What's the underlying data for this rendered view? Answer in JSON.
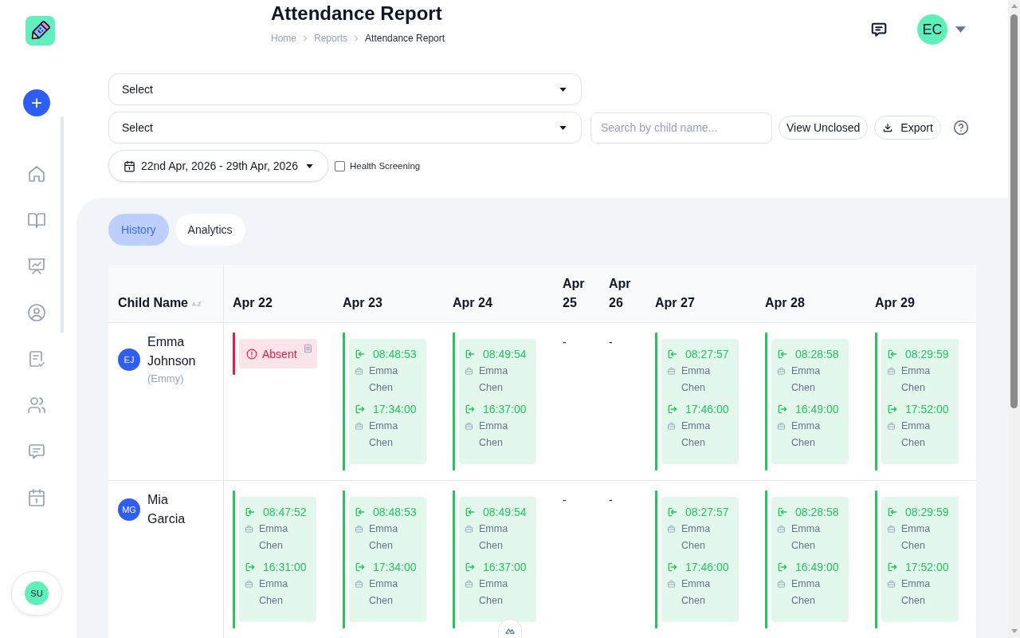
{
  "sidebar": {
    "user": {
      "initials": "SU"
    }
  },
  "header": {
    "title": "Attendance Report",
    "breadcrumb": [
      {
        "label": "Home",
        "current": false
      },
      {
        "label": "Reports",
        "current": false
      },
      {
        "label": "Attendance Report",
        "current": true
      }
    ],
    "user": {
      "initials": "EC"
    }
  },
  "filters": {
    "selects": [
      {
        "value": "Select"
      },
      {
        "value": "Select"
      }
    ],
    "search": {
      "placeholder": "Search by child name..."
    },
    "buttons": [
      {
        "label": "View Unclosed",
        "kind": "plain"
      },
      {
        "label": "Export",
        "kind": "download"
      }
    ],
    "date_range": {
      "value": "22nd Apr, 2026 - 29th Apr, 2026"
    },
    "health_screening": {
      "label": "Health Screening",
      "checked": false
    }
  },
  "tabs": [
    {
      "label": "History",
      "selected": true
    },
    {
      "label": "Analytics",
      "selected": false
    }
  ],
  "table": {
    "columns": [
      {
        "label": "Child Name",
        "sort": "A-Z"
      },
      {
        "label": "Apr 22"
      },
      {
        "label": "Apr 23"
      },
      {
        "label": "Apr 24"
      },
      {
        "label": "Apr 25"
      },
      {
        "label": "Apr 26"
      },
      {
        "label": "Apr 27"
      },
      {
        "label": "Apr 28"
      },
      {
        "label": "Apr 29"
      }
    ],
    "rows": [
      {
        "cells": [
          {
            "kind": "child",
            "initials": "EJ",
            "name": "Emma Johnson",
            "nickname": "(Emmy)"
          },
          {
            "kind": "absent",
            "label": "Absent"
          },
          {
            "kind": "present",
            "check_in": {
              "time": "08:48:53",
              "by": "Emma Chen"
            },
            "check_out": {
              "time": "17:34:00",
              "by": "Emma Chen"
            }
          },
          {
            "kind": "present",
            "check_in": {
              "time": "08:49:54",
              "by": "Emma Chen"
            },
            "check_out": {
              "time": "16:37:00",
              "by": "Emma Chen"
            }
          },
          {
            "kind": "empty",
            "text": "-"
          },
          {
            "kind": "empty",
            "text": "-"
          },
          {
            "kind": "present",
            "check_in": {
              "time": "08:27:57",
              "by": "Emma Chen"
            },
            "check_out": {
              "time": "17:46:00",
              "by": "Emma Chen"
            }
          },
          {
            "kind": "present",
            "check_in": {
              "time": "08:28:58",
              "by": "Emma Chen"
            },
            "check_out": {
              "time": "16:49:00",
              "by": "Emma Chen"
            }
          },
          {
            "kind": "present",
            "check_in": {
              "time": "08:29:59",
              "by": "Emma Chen"
            },
            "check_out": {
              "time": "17:52:00",
              "by": "Emma Chen"
            }
          }
        ]
      },
      {
        "cells": [
          {
            "kind": "child",
            "initials": "MG",
            "name": "Mia Garcia"
          },
          {
            "kind": "present",
            "check_in": {
              "time": "08:47:52",
              "by": "Emma Chen"
            },
            "check_out": {
              "time": "16:31:00",
              "by": "Emma Chen"
            }
          },
          {
            "kind": "present",
            "check_in": {
              "time": "08:48:53",
              "by": "Emma Chen"
            },
            "check_out": {
              "time": "17:34:00",
              "by": "Emma Chen"
            }
          },
          {
            "kind": "present",
            "check_in": {
              "time": "08:49:54",
              "by": "Emma Chen"
            },
            "check_out": {
              "time": "16:37:00",
              "by": "Emma Chen"
            }
          },
          {
            "kind": "empty",
            "text": "-"
          },
          {
            "kind": "empty",
            "text": "-"
          },
          {
            "kind": "present",
            "check_in": {
              "time": "08:27:57",
              "by": "Emma Chen"
            },
            "check_out": {
              "time": "17:46:00",
              "by": "Emma Chen"
            }
          },
          {
            "kind": "present",
            "check_in": {
              "time": "08:28:58",
              "by": "Emma Chen"
            },
            "check_out": {
              "time": "16:49:00",
              "by": "Emma Chen"
            }
          },
          {
            "kind": "present",
            "check_in": {
              "time": "08:29:59",
              "by": "Emma Chen"
            },
            "check_out": {
              "time": "17:52:00",
              "by": "Emma Chen"
            }
          }
        ]
      }
    ]
  }
}
